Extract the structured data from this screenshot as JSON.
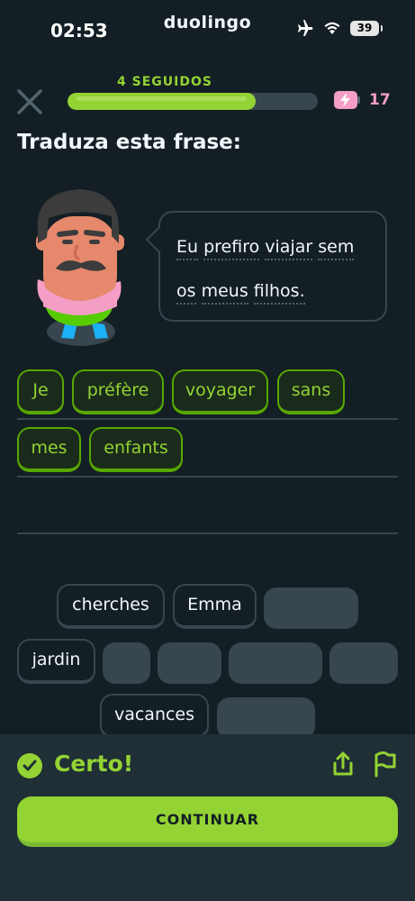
{
  "status_bar": {
    "time": "02:53",
    "app_name": "duolingo",
    "battery": "39"
  },
  "header": {
    "streak_label": "4 SEGUIDOS",
    "progress": 0.75,
    "energy_count": "17"
  },
  "prompt": {
    "title": "Traduza esta frase:"
  },
  "bubble": {
    "line1_words": [
      "Eu",
      "prefiro",
      "viajar",
      "sem"
    ],
    "line2_words": [
      "os",
      "meus",
      "filhos."
    ]
  },
  "answer": {
    "words": [
      "Je",
      "préfère",
      "voyager",
      "sans",
      "mes",
      "enfants"
    ]
  },
  "bank": {
    "words": [
      "cherches",
      "Emma",
      "jardin",
      "vacances"
    ]
  },
  "footer": {
    "result_label": "Certo!",
    "continue_label": "CONTINUAR"
  },
  "colors": {
    "accent": "#93d333",
    "background": "#131f24",
    "footer": "#202f36",
    "energy": "#f49ec5"
  }
}
